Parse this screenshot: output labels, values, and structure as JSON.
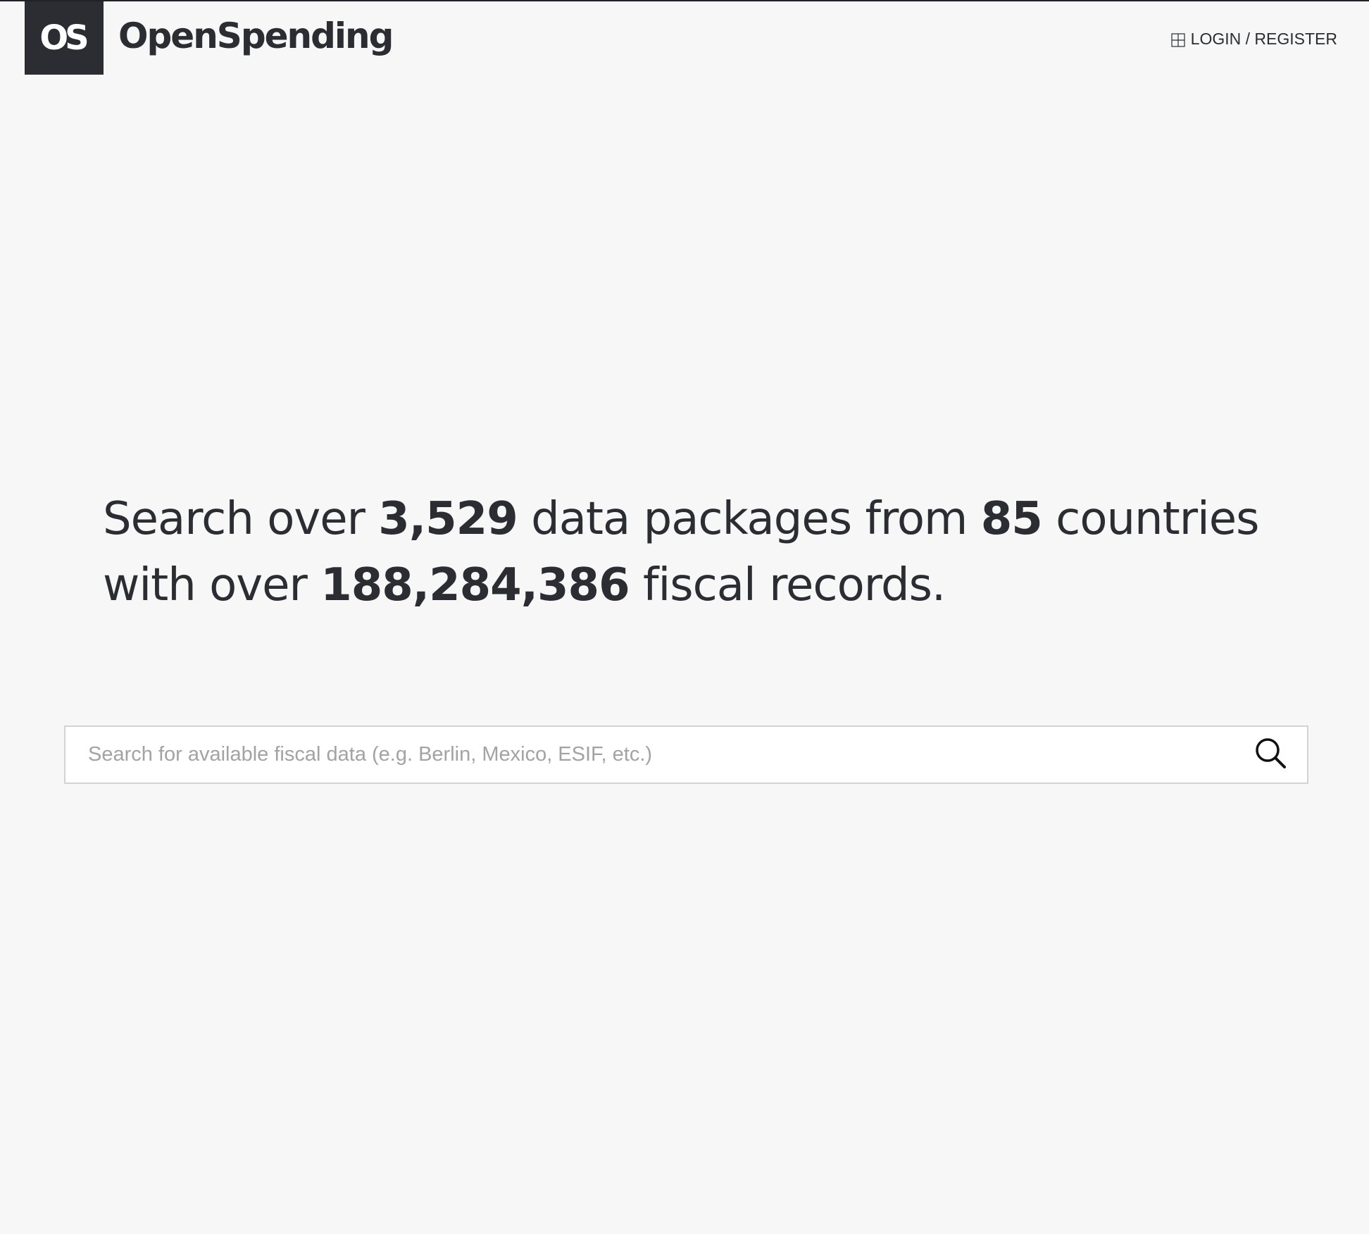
{
  "header": {
    "logo_mark": "OS",
    "brand_name": "OpenSpending",
    "login_label": "LOGIN / REGISTER"
  },
  "hero": {
    "text_1": "Search over ",
    "packages_count": "3,529",
    "text_2": " data packages from ",
    "countries_count": "85",
    "text_3": " countries with over ",
    "records_count": "188,284,386",
    "text_4": " fiscal records."
  },
  "search": {
    "placeholder": "Search for available fiscal data (e.g. Berlin, Mexico, ESIF, etc.)",
    "value": ""
  },
  "icons": {
    "login": "grid-icon",
    "search": "search-icon"
  },
  "colors": {
    "background": "#f7f7f7",
    "brand_dark": "#2b2d33",
    "search_border": "#d3d3d3",
    "placeholder": "#a3a3a3"
  }
}
